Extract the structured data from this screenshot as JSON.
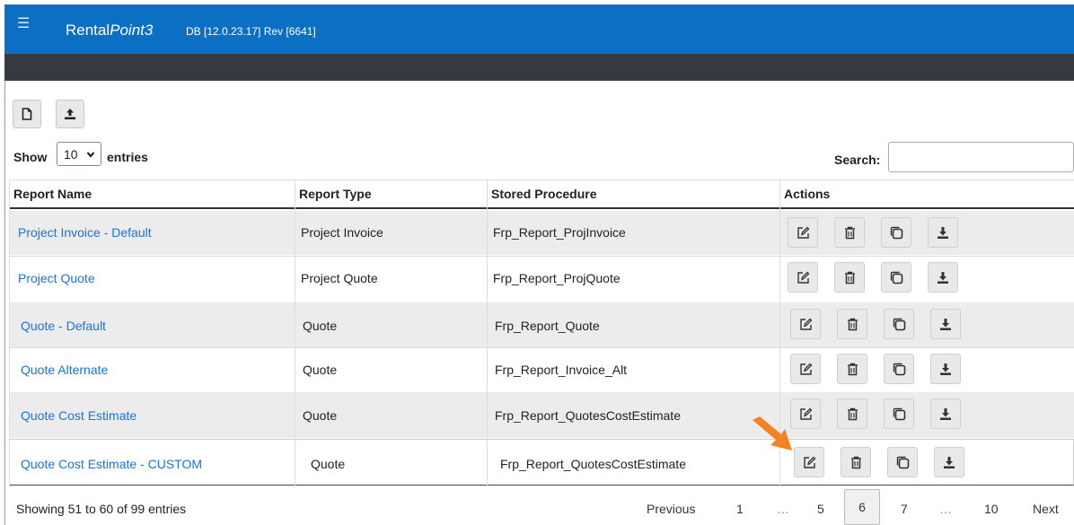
{
  "header": {
    "app_name_plain": "Rental",
    "app_name_italic": "Point3",
    "db_info": "DB [12.0.23.17]  Rev [6641]",
    "menu_icon": "hamburger-icon"
  },
  "toolbar": {
    "new_icon": "new-document-icon",
    "upload_icon": "upload-icon"
  },
  "length_menu": {
    "show_label": "Show",
    "selected": "10",
    "entries_label": "entries"
  },
  "search": {
    "label": "Search:",
    "value": ""
  },
  "table": {
    "headers": [
      "Report Name",
      "Report Type",
      "Stored Procedure",
      "Actions"
    ],
    "action_icons": [
      "edit-icon",
      "trash-icon",
      "copy-icon",
      "download-icon"
    ],
    "rows": [
      {
        "name": "Project Invoice - Default",
        "type": "Project Invoice",
        "procedure": "Frp_Report_ProjInvoice"
      },
      {
        "name": "Project Quote",
        "type": "Project Quote",
        "procedure": "Frp_Report_ProjQuote"
      },
      {
        "name": "Quote - Default",
        "type": "Quote",
        "procedure": "Frp_Report_Quote"
      },
      {
        "name": "Quote Alternate",
        "type": "Quote",
        "procedure": "Frp_Report_Invoice_Alt"
      },
      {
        "name": "Quote Cost Estimate",
        "type": "Quote",
        "procedure": "Frp_Report_QuotesCostEstimate"
      },
      {
        "name": "Quote Cost Estimate - CUSTOM",
        "type": "Quote",
        "procedure": "Frp_Report_QuotesCostEstimate"
      }
    ]
  },
  "footer": {
    "info": "Showing 51 to 60 of 99 entries",
    "pagination": {
      "previous": "Previous",
      "pages": [
        "1",
        "…",
        "5",
        "6",
        "7",
        "…",
        "10"
      ],
      "current": "6",
      "next": "Next"
    }
  },
  "colors": {
    "topbar": "#0b6fc4",
    "darkbar": "#343a40",
    "link": "#1a73d9",
    "row_stripe": "#ececec",
    "annotation_arrow": "#f58220"
  }
}
